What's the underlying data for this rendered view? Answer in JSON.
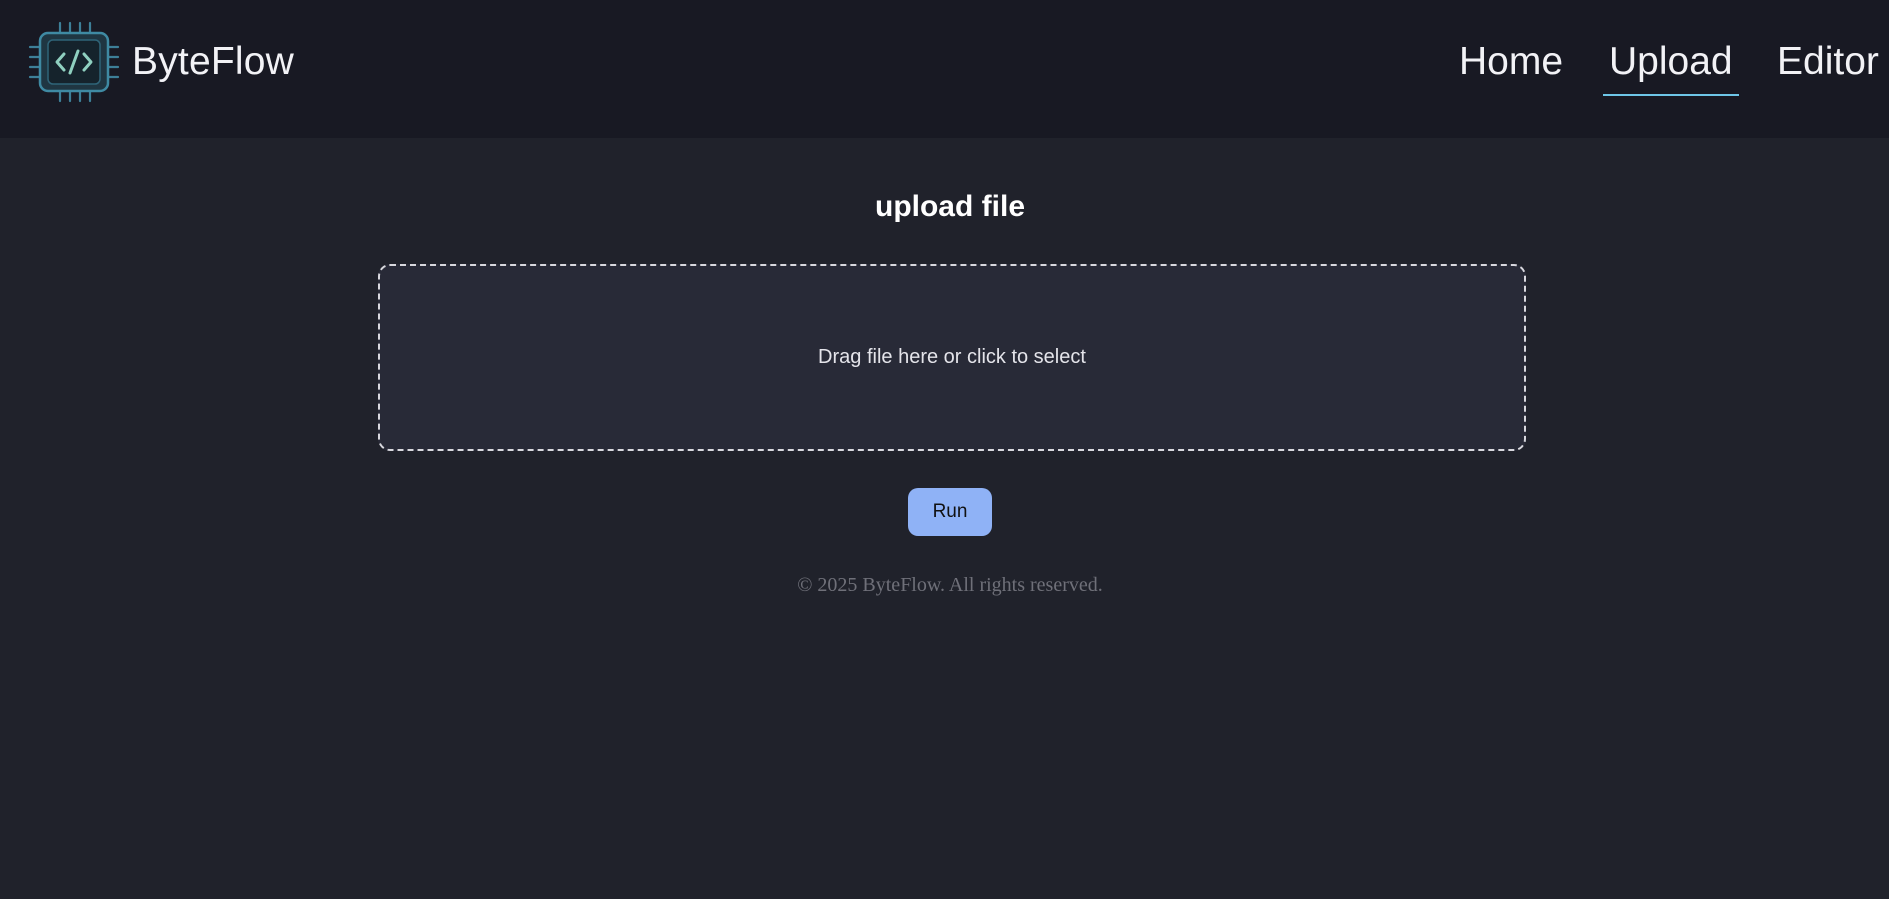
{
  "header": {
    "brand_name": "ByteFlow",
    "logo_icon": "chip-code-icon",
    "nav": {
      "home": "Home",
      "upload": "Upload",
      "editor": "Editor"
    },
    "active_nav": "upload"
  },
  "main": {
    "title": "upload file",
    "dropzone_text": "Drag file here or click to select",
    "run_label": "Run"
  },
  "footer": {
    "text": "© 2025 ByteFlow. All rights reserved."
  },
  "colors": {
    "header_bg": "#181923",
    "page_bg": "#20222b",
    "dropzone_bg": "#282a37",
    "accent_underline": "#6ec6e8",
    "button_bg": "#8fb2f6"
  }
}
